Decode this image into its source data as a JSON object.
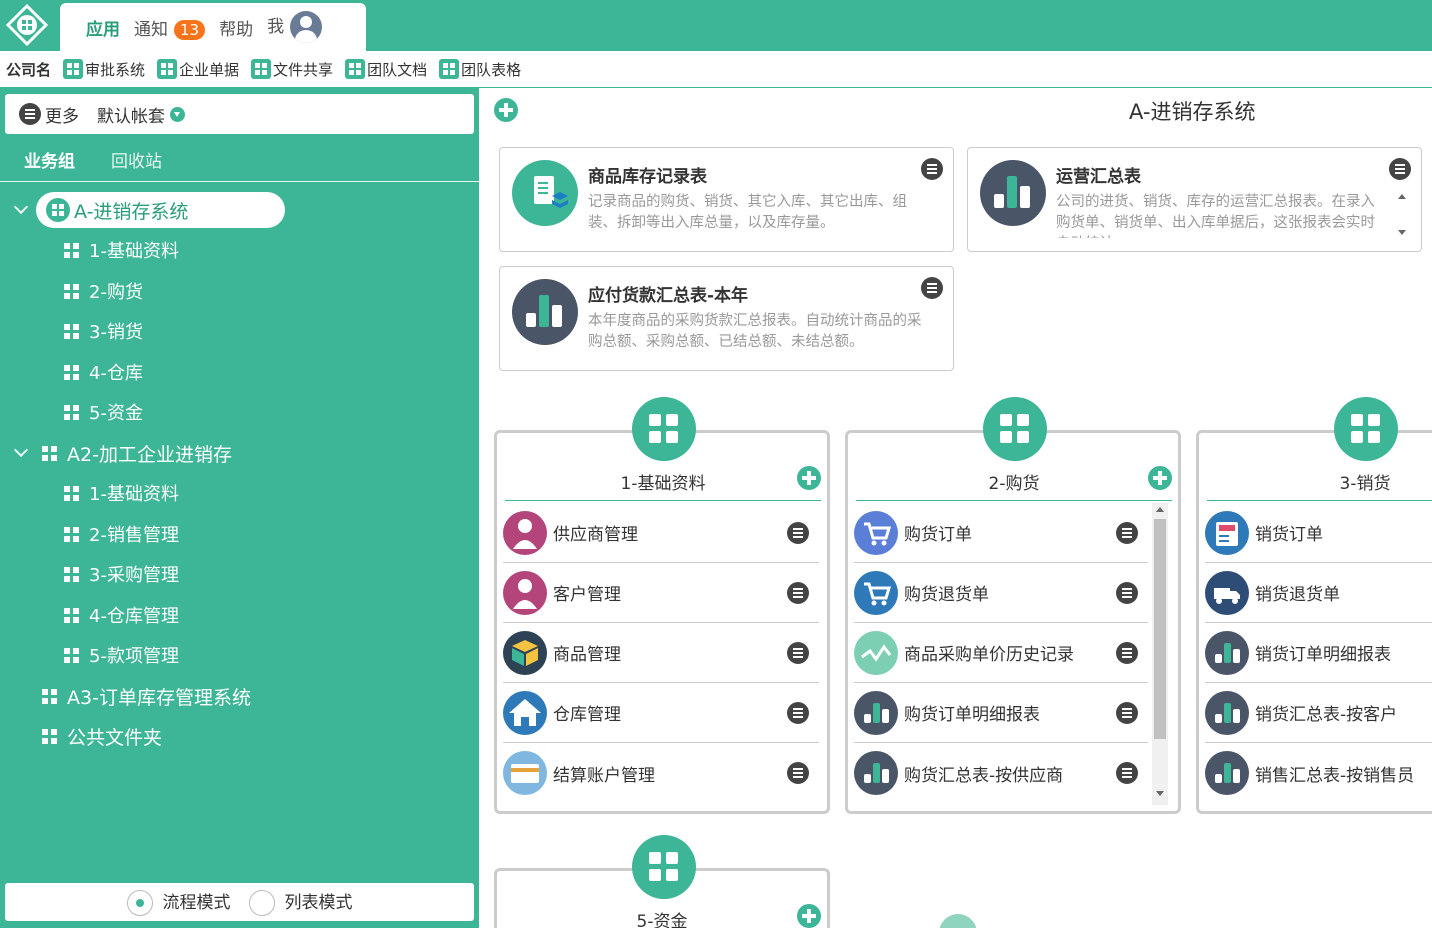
{
  "topbar": {
    "tabs": [
      {
        "label": "应用"
      },
      {
        "label": "通知"
      },
      {
        "label": "帮助"
      },
      {
        "label": "我"
      }
    ],
    "notify_count": "13"
  },
  "appbar": {
    "company": "公司名",
    "apps": [
      "审批系统",
      "企业单据",
      "文件共享",
      "团队文档",
      "团队表格"
    ]
  },
  "sidebar": {
    "more_label": "更多",
    "account": "默认帐套",
    "tabs": [
      "业务组",
      "回收站"
    ],
    "tree": {
      "selected": "A-进销存系统",
      "a_children": [
        "1-基础资料",
        "2-购货",
        "3-销货",
        "4-仓库",
        "5-资金"
      ],
      "a2": "A2-加工企业进销存",
      "a2_children": [
        "1-基础资料",
        "2-销售管理",
        "3-采购管理",
        "4-仓库管理",
        "5-款项管理"
      ],
      "a3": "A3-订单库存管理系统",
      "public": "公共文件夹"
    },
    "modes": [
      "流程模式",
      "列表模式"
    ]
  },
  "main": {
    "title": "A-进销存系统",
    "cards": [
      {
        "title": "商品库存记录表",
        "desc": "记录商品的购货、销货、其它入库、其它出库、组装、拆卸等出入库总量，以及库存量。"
      },
      {
        "title": "运营汇总表",
        "desc": "公司的进货、销货、库存的运营汇总报表。在录入购货单、销货单、出入库单据后，这张报表会实时自动统计。"
      },
      {
        "title": "应付货款汇总表-本年",
        "desc": "本年度商品的采购货款汇总报表。自动统计商品的采购总额、采购总额、已结总额、未结总额。"
      }
    ],
    "modules": [
      {
        "title": "1-基础资料",
        "items": [
          "供应商管理",
          "客户管理",
          "商品管理",
          "仓库管理",
          "结算账户管理"
        ]
      },
      {
        "title": "2-购货",
        "items": [
          "购货订单",
          "购货退货单",
          "商品采购单价历史记录",
          "购货订单明细报表",
          "购货汇总表-按供应商"
        ]
      },
      {
        "title": "3-销货",
        "items": [
          "销货订单",
          "销货退货单",
          "销货订单明细报表",
          "销货汇总表-按客户",
          "销售汇总表-按销售员"
        ]
      },
      {
        "title": "5-资金",
        "items": []
      }
    ]
  },
  "colors": {
    "accent": "#3db597",
    "badge": "#f7741b"
  }
}
